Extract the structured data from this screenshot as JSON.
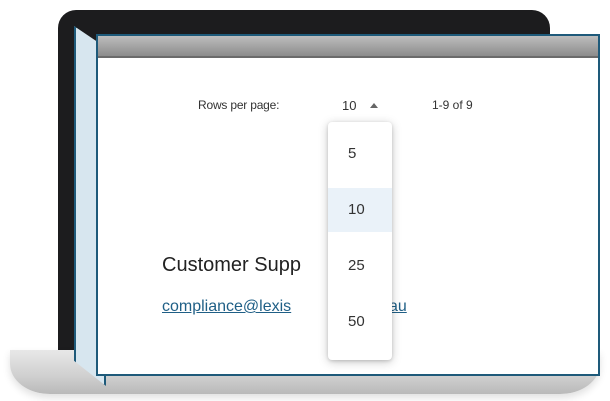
{
  "pagination": {
    "rows_label": "Rows per page:",
    "rows_value": "10",
    "range_text": "1-9 of 9"
  },
  "dropdown": {
    "options": [
      "5",
      "10",
      "25",
      "50"
    ],
    "selected": "10"
  },
  "support": {
    "title": "Customer Supp",
    "email": "compliance@lexis",
    "email_tail": "m.au"
  },
  "colors": {
    "frame": "#1e5a7a",
    "link": "#1f5f86",
    "selected_bg": "#eaf2f9"
  }
}
